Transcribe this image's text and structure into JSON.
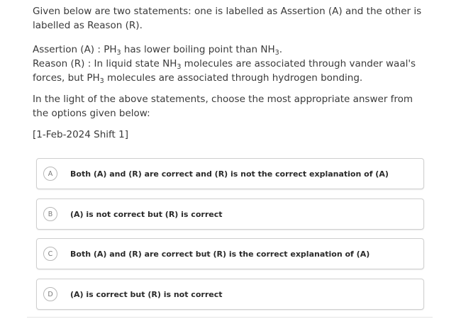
{
  "question": {
    "intro": "Given below are two statements: one is labelled as Assertion (A) and the other is labelled as Reason (R).",
    "assertion": {
      "prefix": "Assertion (A) : PH",
      "sub1": "3",
      "mid": " has lower boiling point than NH",
      "sub2": "3",
      "suffix": "."
    },
    "reason": {
      "prefix": "Reason (R) : In liquid state NH",
      "sub1": "3",
      "mid": " molecules are associated through vander waal's forces, but PH",
      "sub2": "3",
      "suffix": " molecules are associated through hydrogen bonding."
    },
    "instruction": "In the light of the above statements, choose the most appropriate answer from the options given below:",
    "source": "[1-Feb-2024 Shift 1]"
  },
  "options": [
    {
      "letter": "A",
      "text": "Both (A) and (R) are correct and (R) is not the correct explanation of (A)"
    },
    {
      "letter": "B",
      "text": "(A) is not correct but (R) is correct"
    },
    {
      "letter": "C",
      "text": "Both (A) and (R) are correct but (R) is the correct explanation of (A)"
    },
    {
      "letter": "D",
      "text": "(A) is correct but (R) is not correct"
    }
  ]
}
